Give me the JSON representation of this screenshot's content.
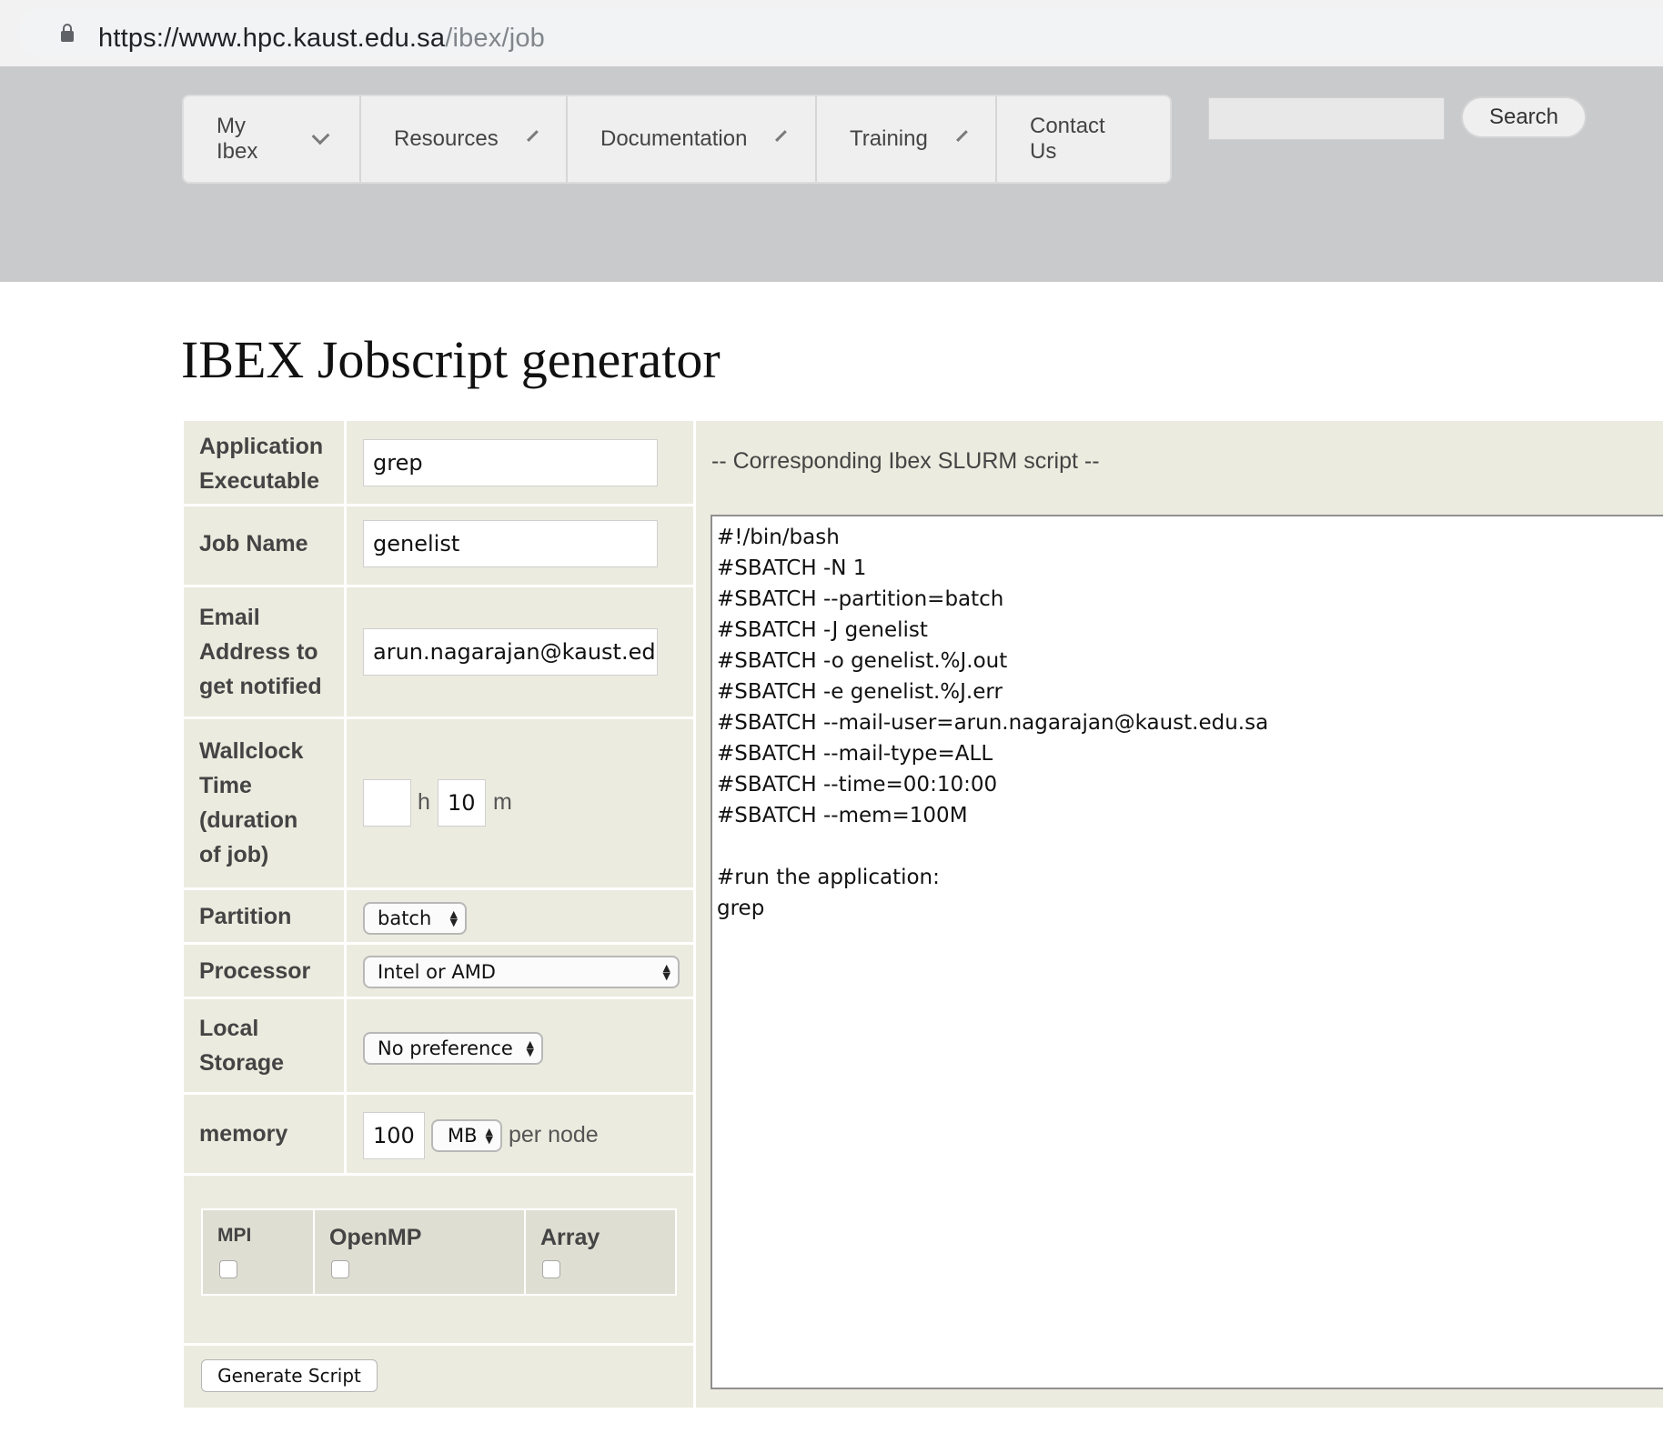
{
  "browser": {
    "url_host": "https://www.hpc.kaust.edu.sa",
    "url_path": "/ibex/job"
  },
  "nav": {
    "items": [
      {
        "label": "My Ibex",
        "has_dropdown": true
      },
      {
        "label": "Resources",
        "has_dropdown": true
      },
      {
        "label": "Documentation",
        "has_dropdown": true
      },
      {
        "label": "Training",
        "has_dropdown": true
      },
      {
        "label": "Contact Us",
        "has_dropdown": false
      }
    ],
    "search_value": "",
    "search_button": "Search"
  },
  "page": {
    "title": "IBEX Jobscript generator"
  },
  "form": {
    "application": {
      "label_line1": "Application",
      "label_line2": "Executable",
      "value": "grep"
    },
    "job_name": {
      "label": "Job Name",
      "value": "genelist"
    },
    "email": {
      "label_line1": "Email",
      "label_line2": "Address to",
      "label_line3": "get notified",
      "value": "arun.nagarajan@kaust.edu.sa"
    },
    "wallclock": {
      "label_line1": "Wallclock",
      "label_line2": "Time",
      "label_line3": "(duration",
      "label_line4": "of job)",
      "hours": "",
      "hours_unit": "h",
      "minutes": "10",
      "minutes_unit": "m"
    },
    "partition": {
      "label": "Partition",
      "selected": "batch"
    },
    "processor": {
      "label": "Processor",
      "selected": "Intel or AMD"
    },
    "local_storage": {
      "label_line1": "Local",
      "label_line2": "Storage",
      "selected": "No preference"
    },
    "memory": {
      "label": "memory",
      "value": "100",
      "unit_selected": "MB",
      "suffix": "per node"
    },
    "options": [
      {
        "label": "MPI",
        "checked": false
      },
      {
        "label": "OpenMP",
        "checked": false
      },
      {
        "label": "Array",
        "checked": false
      }
    ],
    "generate_button": "Generate Script"
  },
  "script": {
    "header": "-- Corresponding Ibex SLURM script --",
    "lines": [
      "#!/bin/bash",
      "#SBATCH -N 1",
      "#SBATCH --partition=batch",
      "#SBATCH -J genelist",
      "#SBATCH -o genelist.%J.out",
      "#SBATCH -e genelist.%J.err",
      "#SBATCH --mail-user=arun.nagarajan@kaust.edu.sa",
      "#SBATCH --mail-type=ALL",
      "#SBATCH --time=00:10:00",
      "#SBATCH --mem=100M",
      "",
      "#run the application:",
      "grep"
    ]
  }
}
